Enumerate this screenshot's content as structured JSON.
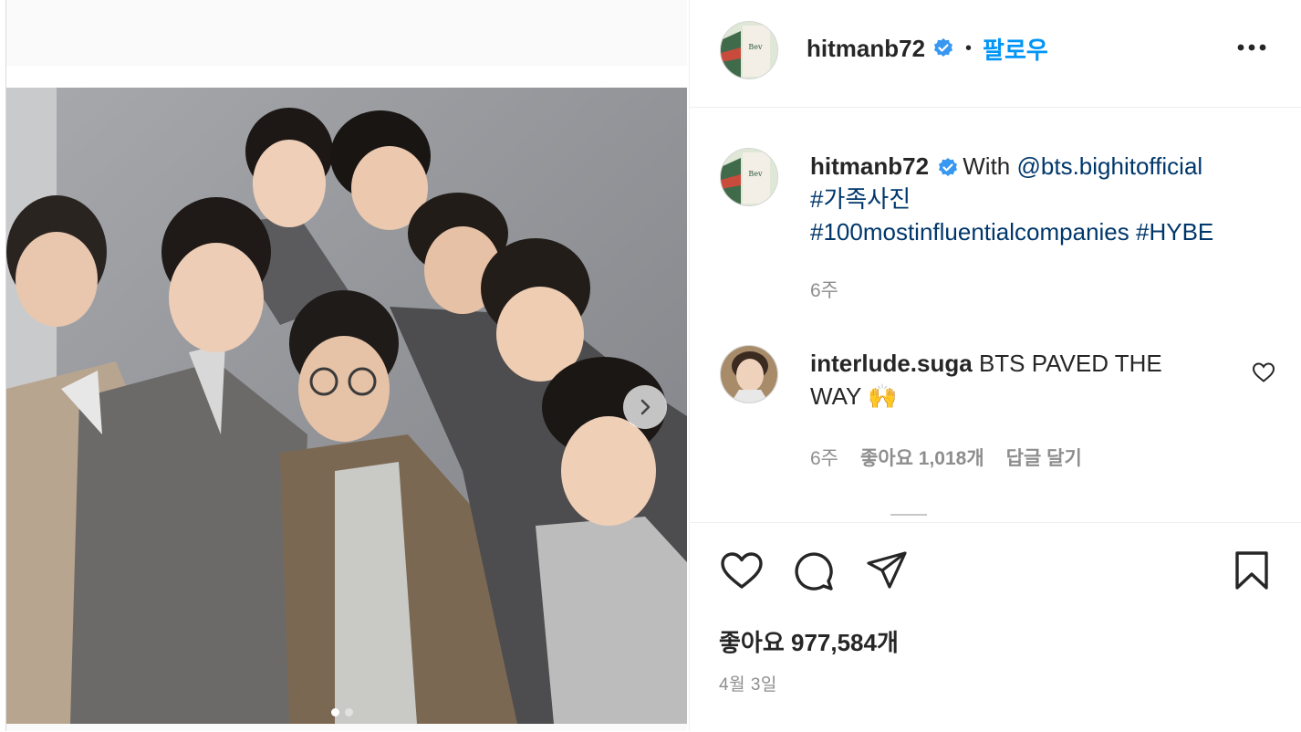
{
  "post": {
    "author": "hitmanb72",
    "follow_label": "팔로우",
    "separator": "•",
    "caption": {
      "author": "hitmanb72",
      "prefix": "With ",
      "mention": "@bts.bighitofficial",
      "hashtags": [
        "#가족사진",
        "#100mostinfluentialcompanies",
        "#HYBE"
      ],
      "time": "6주"
    },
    "comments": [
      {
        "author": "interlude.suga",
        "text": "BTS PAVED THE WAY 🙌",
        "time": "6주",
        "likes_label": "좋아요 1,018개",
        "reply_label": "답글 달기"
      }
    ],
    "likes_label": "좋아요 977,584개",
    "date": "4월 3일"
  },
  "carousel": {
    "total": 2,
    "current": 1
  },
  "icons": {
    "verified": "verified-badge-icon",
    "more": "more-options-icon",
    "like": "heart-icon",
    "comment": "comment-icon",
    "share": "share-icon",
    "save": "bookmark-icon",
    "next": "chevron-right-icon"
  },
  "colors": {
    "link": "#00376b",
    "follow": "#0095f6",
    "verified": "#3897f0",
    "meta": "#8e8e8e"
  }
}
